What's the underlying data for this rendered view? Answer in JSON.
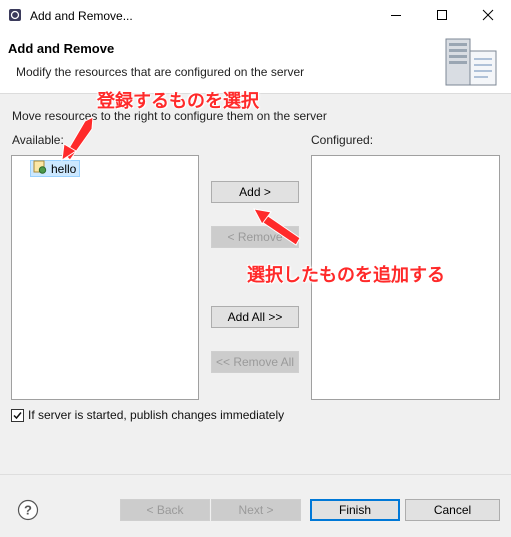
{
  "window": {
    "title": "Add and Remove...",
    "icons": {
      "app": "eclipse-icon",
      "minimize": "minimize-icon",
      "maximize": "maximize-icon",
      "close": "close-icon"
    }
  },
  "header": {
    "title": "Add and Remove",
    "description": "Modify the resources that are configured on the server",
    "icon": "server-icon"
  },
  "body": {
    "instruction": "Move resources to the right to configure them on the server",
    "available_label": "Available:",
    "configured_label": "Configured:",
    "available_items": [
      {
        "label": "hello",
        "icon": "web-project-icon",
        "selected": true
      }
    ],
    "configured_items": []
  },
  "buttons": {
    "add": "Add >",
    "remove": "< Remove",
    "add_all": "Add All >>",
    "remove_all": "<< Remove All"
  },
  "publish": {
    "label": "If server is started, publish changes immediately",
    "checked": true
  },
  "footer": {
    "help_icon": "help-icon",
    "back": "< Back",
    "next": "Next >",
    "finish": "Finish",
    "cancel": "Cancel"
  },
  "annotations": {
    "select_note": "登録するものを選択",
    "add_note": "選択したものを追加する",
    "color": "#ff2a2a"
  }
}
